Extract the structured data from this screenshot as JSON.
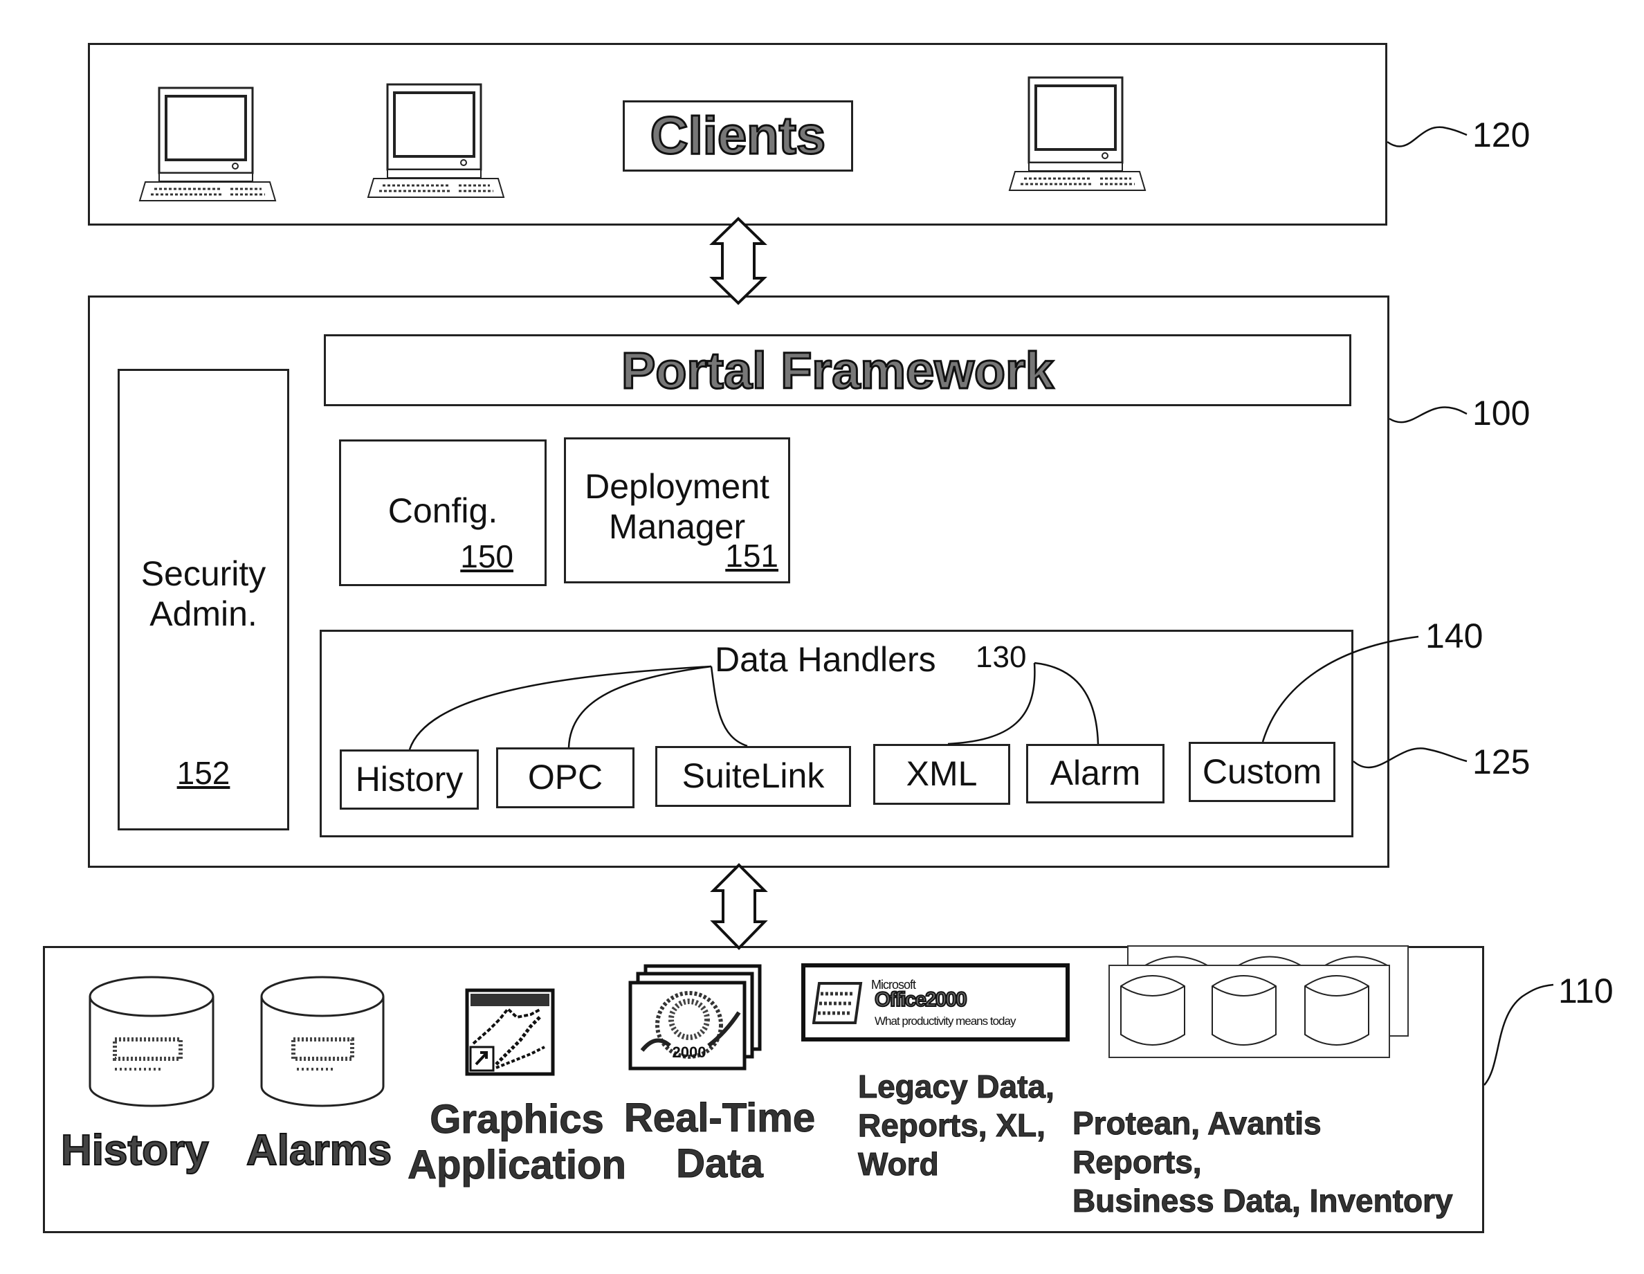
{
  "clients": {
    "title": "Clients",
    "ref": "120",
    "computers": [
      "computer-1",
      "computer-2",
      "computer-3"
    ]
  },
  "portal": {
    "title": "Portal Framework",
    "ref": "100",
    "security": {
      "line1": "Security",
      "line2": "Admin.",
      "ref": "152"
    },
    "config": {
      "label": "Config.",
      "ref": "150"
    },
    "deployment": {
      "line1": "Deployment",
      "line2": "Manager",
      "ref": "151"
    },
    "data_handlers": {
      "label": "Data Handlers",
      "ref": "130",
      "box_ref": "125",
      "custom_ref": "140",
      "items": [
        "History",
        "OPC",
        "SuiteLink",
        "XML",
        "Alarm",
        "Custom"
      ]
    }
  },
  "sources": {
    "ref": "110",
    "history": "History",
    "alarms": "Alarms",
    "graphics": {
      "line1": "Graphics",
      "line2": "Application"
    },
    "realtime": {
      "line1": "Real-Time",
      "line2": "Data"
    },
    "office_logo": {
      "brand": "Microsoft",
      "product": "Office2000",
      "tagline": "What productivity means today"
    },
    "legacy": {
      "line1": "Legacy Data,",
      "line2": "Reports, XL,",
      "line3": "Word"
    },
    "business": {
      "line1": "Protean, Avantis",
      "line2": "Reports,",
      "line3": "Business Data, Inventory"
    }
  }
}
